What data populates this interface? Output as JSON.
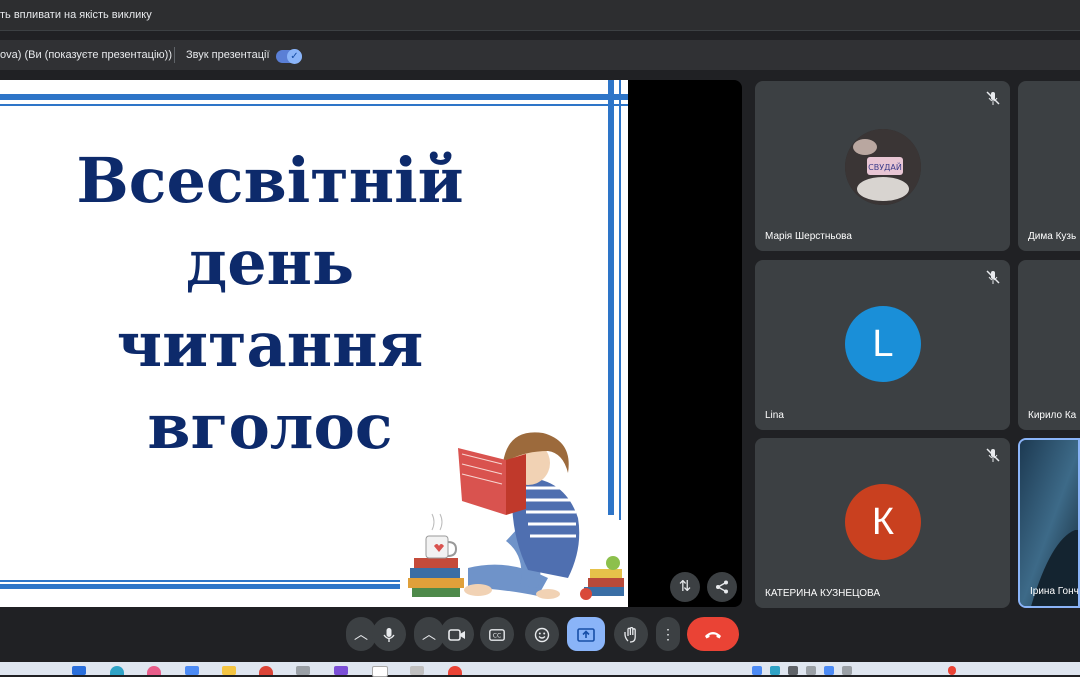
{
  "warning": {
    "text": "ть впливати на якість виклику"
  },
  "presentation_bar": {
    "presenter_label": "ova) (Ви (показуєте презентацію))",
    "sound_label": "Звук презентації",
    "sound_on": true
  },
  "slide": {
    "lines": [
      "Всесвітній",
      "день",
      "читання",
      "вголос"
    ]
  },
  "participants": [
    {
      "name": "Марія Шерстньова",
      "avatar": "photo",
      "muted": true
    },
    {
      "name": "Дима Кузь",
      "muted": false
    },
    {
      "name": "Lina",
      "initial": "L",
      "color": "#1a8fd8",
      "muted": true
    },
    {
      "name": "Кирило Ка",
      "muted": false
    },
    {
      "name": "КАТЕРИНА КУЗНЕЦОВА",
      "initial": "К",
      "color": "#c9401f",
      "muted": true
    },
    {
      "name": "Ірина Гонча",
      "avatar": "video",
      "muted": false
    }
  ],
  "controls": {
    "end_call_color": "#ea4335",
    "present_active_color": "#8ab4f8",
    "icons": [
      "chevron-up-icon",
      "mic-icon",
      "chevron-up-icon",
      "camera-icon",
      "captions-icon",
      "emoji-icon",
      "present-icon",
      "raise-hand-icon",
      "more-icon",
      "end-call-icon"
    ]
  }
}
